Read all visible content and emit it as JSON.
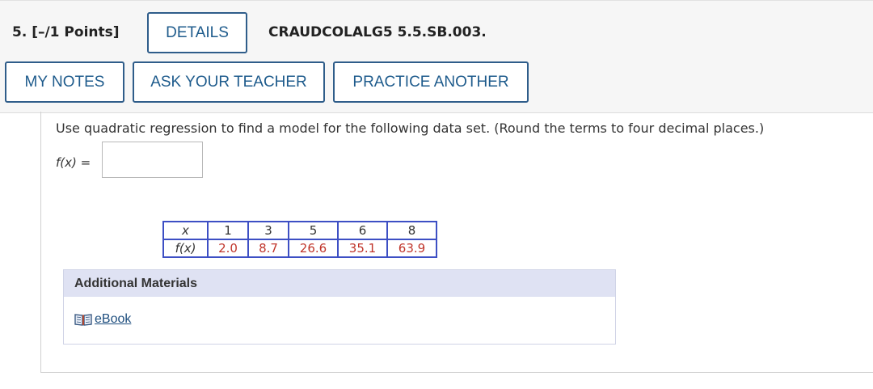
{
  "header": {
    "question_number": "5.  [–/1 Points]",
    "details_label": "DETAILS",
    "problem_code": "CRAUDCOLALG5 5.5.SB.003."
  },
  "actions": {
    "my_notes_label": "MY NOTES",
    "ask_teacher_label": "ASK YOUR TEACHER",
    "practice_another_label": "PRACTICE ANOTHER"
  },
  "question": {
    "prompt": "Use quadratic regression to find a model for the following data set. (Round the terms to four decimal places.)",
    "fx_label": "f(x)",
    "equals": "=",
    "answer_value": ""
  },
  "data_table": {
    "x_header": "x",
    "fx_header": "f(x)",
    "x_values": [
      "1",
      "3",
      "5",
      "6",
      "8"
    ],
    "fx_values": [
      "2.0",
      "8.7",
      "26.6",
      "35.1",
      "63.9"
    ]
  },
  "additional_materials": {
    "heading": "Additional Materials",
    "ebook_label": "eBook",
    "ebook_icon": "book-icon"
  }
}
